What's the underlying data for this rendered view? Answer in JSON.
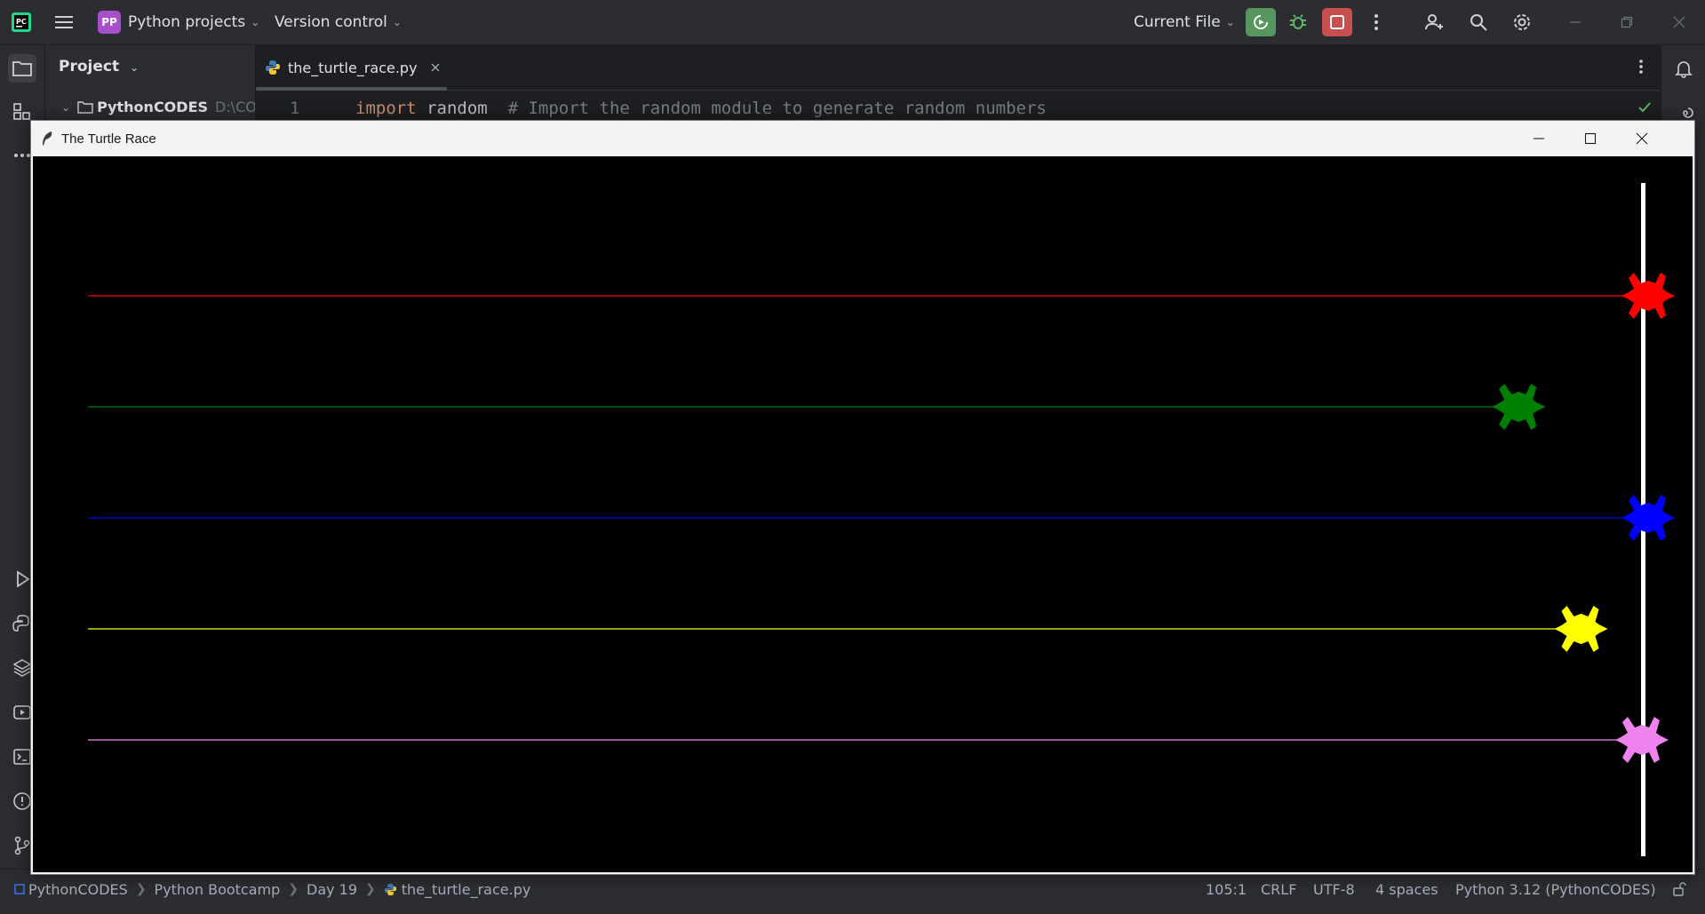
{
  "ide": {
    "project_badge": "PP",
    "project_name": "Python projects",
    "vcs": "Version control",
    "run_config": "Current File",
    "colors": {
      "run": "#57965c",
      "stop": "#c94f4f",
      "badge": "#a64ecb"
    }
  },
  "project_panel": {
    "title": "Project",
    "root_name": "PythonCODES",
    "root_path": "D:\\CO"
  },
  "editor": {
    "tab_label": "the_turtle_race.py",
    "line_number": "1",
    "code_keyword": "import",
    "code_text": " random  ",
    "code_comment": "# Import the random module to generate random numbers"
  },
  "turtle_window": {
    "title": "The Turtle Race",
    "racers": [
      {
        "color": "red",
        "progress": 1.0
      },
      {
        "color": "green",
        "progress": 0.917
      },
      {
        "color": "blue",
        "progress": 1.0
      },
      {
        "color": "yellow",
        "progress": 0.957
      },
      {
        "color": "violet",
        "progress": 0.996
      }
    ],
    "finish_line_color": "white"
  },
  "statusbar": {
    "crumbs": [
      "PythonCODES",
      "Python Bootcamp",
      "Day 19",
      "the_turtle_race.py"
    ],
    "position": "105:1",
    "line_sep": "CRLF",
    "encoding": "UTF-8",
    "indent": "4 spaces",
    "interpreter": "Python 3.12 (PythonCODES)"
  }
}
